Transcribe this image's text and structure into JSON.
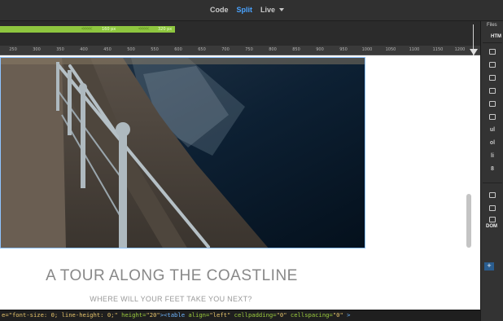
{
  "view_switcher": {
    "code": "Code",
    "split": "Split",
    "live": "Live"
  },
  "media_queries": {
    "mid_label": "160 px",
    "end_label": "320 px",
    "color": "#8ec63f"
  },
  "ruler": {
    "ticks": [
      "250",
      "300",
      "350",
      "400",
      "450",
      "500",
      "550",
      "600",
      "650",
      "700",
      "750",
      "800",
      "850",
      "900",
      "950",
      "1000",
      "1050",
      "1100",
      "1150",
      "1200"
    ]
  },
  "page": {
    "title": "A TOUR ALONG THE COASTLINE",
    "subtitle": "WHERE WILL YOUR FEET TAKE YOU NEXT?"
  },
  "code_line": {
    "str1": "e=\"font-size: 0; line-height: 0;\"",
    "attr1": " height=",
    "str2": "\"20\"",
    "tag": "><table",
    "attr2": " align=",
    "str3": "\"left\"",
    "attr3": "  cellpadding=",
    "str4": "\"0\"",
    "attr4": "  cellspacing=",
    "str5": "\"0\"",
    "close": " >"
  },
  "right_panel": {
    "files_tab": "Files",
    "insert_tab": "HTM",
    "icons": [
      {
        "name": "div-icon",
        "glyph": ""
      },
      {
        "name": "image-icon",
        "glyph": ""
      },
      {
        "name": "paragraph-icon",
        "glyph": ""
      },
      {
        "name": "heading-icon",
        "glyph": ""
      },
      {
        "name": "table-icon",
        "glyph": ""
      },
      {
        "name": "figure-icon",
        "glyph": ""
      },
      {
        "name": "unordered-list-icon",
        "glyph": "ul"
      },
      {
        "name": "ordered-list-icon",
        "glyph": "ol"
      },
      {
        "name": "list-item-icon",
        "glyph": "li"
      },
      {
        "name": "link-icon",
        "glyph": "8"
      },
      {
        "name": "header-icon",
        "glyph": ""
      },
      {
        "name": "navigation-icon",
        "glyph": ""
      },
      {
        "name": "main-icon",
        "glyph": ""
      }
    ],
    "dom_tab": "DOM",
    "add_label": "+"
  },
  "colors": {
    "accent": "#4aa3ff",
    "panel_bg": "#303030",
    "selection_border": "#8ec3ff"
  }
}
